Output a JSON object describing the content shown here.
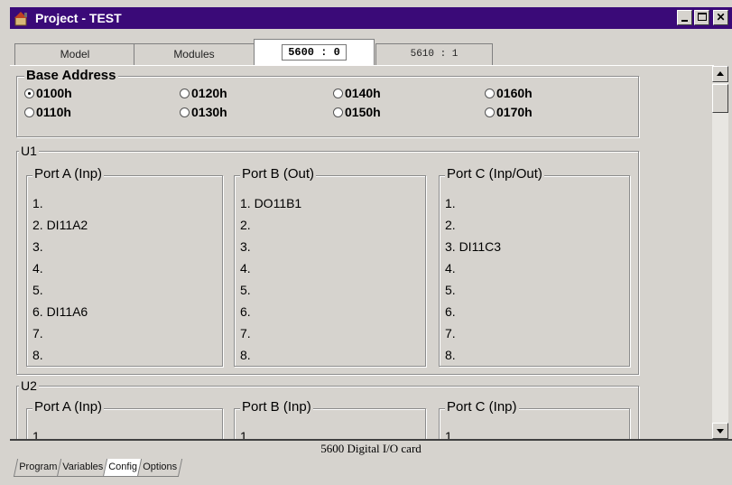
{
  "window": {
    "title": "Project - TEST"
  },
  "tabs": [
    {
      "label": "Model"
    },
    {
      "label": "Modules"
    },
    {
      "label": "5600 : 0"
    },
    {
      "label": "5610 : 1"
    }
  ],
  "base_address": {
    "label": "Base Address",
    "options": [
      "0100h",
      "0120h",
      "0140h",
      "0160h",
      "0110h",
      "0130h",
      "0150h",
      "0170h"
    ],
    "selected": "0100h"
  },
  "units": [
    {
      "label": "U1",
      "ports": [
        {
          "label": "Port A (Inp)",
          "lines": [
            "1.",
            "2. DI11A2",
            "3.",
            "4.",
            "5.",
            "6. DI11A6",
            "7.",
            "8."
          ]
        },
        {
          "label": "Port B (Out)",
          "lines": [
            "1. DO11B1",
            "2.",
            "3.",
            "4.",
            "5.",
            "6.",
            "7.",
            "8."
          ]
        },
        {
          "label": "Port C (Inp/Out)",
          "lines": [
            "1.",
            "2.",
            "3. DI11C3",
            "4.",
            "5.",
            "6.",
            "7.",
            "8."
          ]
        }
      ]
    },
    {
      "label": "U2",
      "ports": [
        {
          "label": "Port A (Inp)",
          "lines": [
            "1."
          ]
        },
        {
          "label": "Port B (Inp)",
          "lines": [
            "1."
          ]
        },
        {
          "label": "Port C (Inp)",
          "lines": [
            "1."
          ]
        }
      ]
    }
  ],
  "status": {
    "text": "5600 Digital I/O card"
  },
  "bottom_tabs": [
    "Program",
    "Variables",
    "Config",
    "Options"
  ],
  "colors": {
    "titlebar": "#3a0a78",
    "face": "#d6d3ce"
  }
}
